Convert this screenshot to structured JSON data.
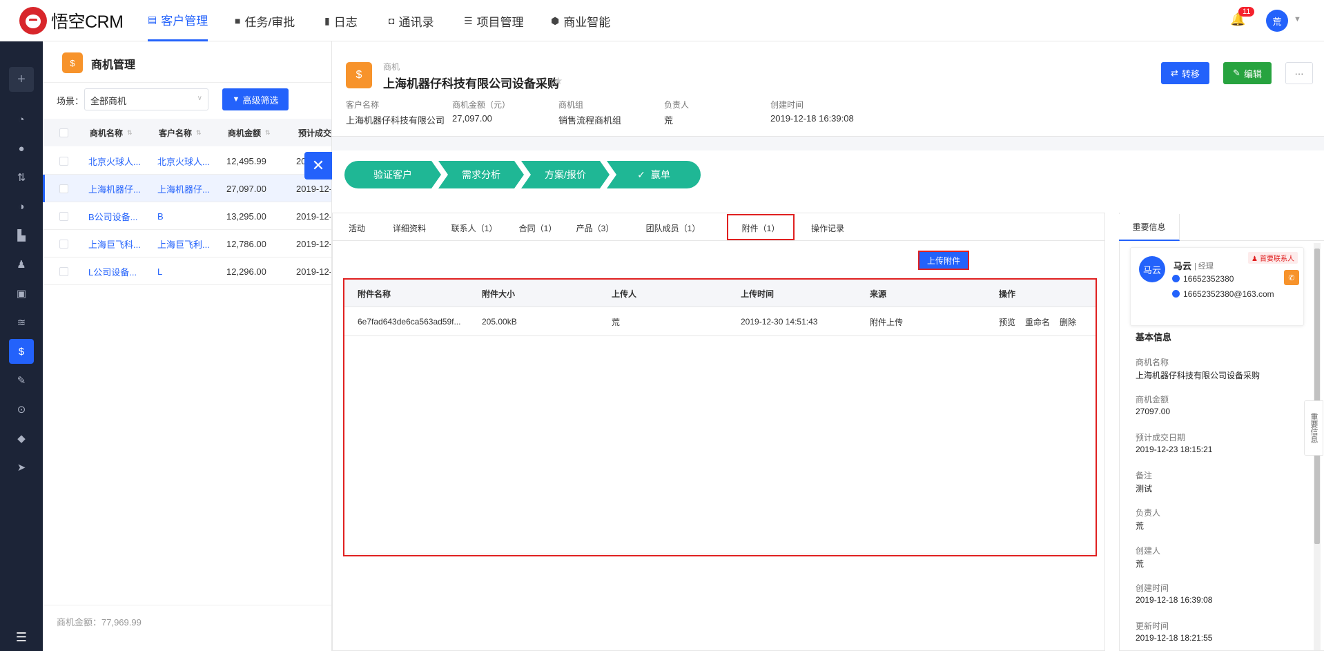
{
  "app": {
    "logo_text": "悟空CRM"
  },
  "nav": [
    {
      "label": "客户管理",
      "icon": "building-icon",
      "active": true
    },
    {
      "label": "任务/审批",
      "icon": "briefcase-icon"
    },
    {
      "label": "日志",
      "icon": "log-icon"
    },
    {
      "label": "通讯录",
      "icon": "contacts-icon"
    },
    {
      "label": "项目管理",
      "icon": "project-icon"
    },
    {
      "label": "商业智能",
      "icon": "bi-icon"
    }
  ],
  "header": {
    "notification_count": "11",
    "user_avatar": "荒"
  },
  "list": {
    "title": "商机管理",
    "scene_label": "场景：",
    "scene_value": "全部商机",
    "filter_button": "高级筛选",
    "columns": [
      "商机名称",
      "客户名称",
      "商机金额",
      "预计成交"
    ],
    "rows": [
      {
        "name": "北京火球人...",
        "customer": "北京火球人...",
        "amount": "12,495.99",
        "date": "20"
      },
      {
        "name": "上海机器仔...",
        "customer": "上海机器仔...",
        "amount": "27,097.00",
        "date": "2019-12-"
      },
      {
        "name": "B公司设备...",
        "customer": "B",
        "amount": "13,295.00",
        "date": "2019-12-"
      },
      {
        "name": "上海巨飞科...",
        "customer": "上海巨飞利...",
        "amount": "12,786.00",
        "date": "2019-12-"
      },
      {
        "name": "L公司设备...",
        "customer": "L",
        "amount": "12,296.00",
        "date": "2019-12-"
      }
    ],
    "summary": "商机金额：77,969.99"
  },
  "detail": {
    "type_label": "商机",
    "name": "上海机器仔科技有限公司设备采购",
    "buttons": {
      "transfer": "转移",
      "edit": "编辑",
      "more": "···"
    },
    "header_fields": [
      {
        "label": "客户名称",
        "value": "上海机器仔科技有限公司"
      },
      {
        "label": "商机金额（元）",
        "value": "27,097.00"
      },
      {
        "label": "商机组",
        "value": "销售流程商机组"
      },
      {
        "label": "负责人",
        "value": "荒"
      },
      {
        "label": "创建时间",
        "value": "2019-12-18 16:39:08"
      }
    ],
    "stages": [
      "验证客户",
      "需求分析",
      "方案/报价",
      "赢单"
    ],
    "tabs": [
      "活动",
      "详细资料",
      "联系人（1）",
      "合同（1）",
      "产品（3）",
      "团队成员（1）",
      "附件（1）",
      "操作记录"
    ],
    "upload_button": "上传附件",
    "attachments": {
      "columns": [
        "附件名称",
        "附件大小",
        "上传人",
        "上传时间",
        "来源",
        "操作"
      ],
      "rows": [
        {
          "name": "6e7fad643de6ca563ad59f...",
          "size": "205.00kB",
          "uploader": "荒",
          "time": "2019-12-30 14:51:43",
          "source": "附件上传",
          "actions": [
            "预览",
            "重命名",
            "删除"
          ]
        }
      ]
    },
    "right_panel": {
      "tab": "重要信息",
      "contact": {
        "avatar": "马云",
        "name": "马云",
        "role": "| 经理",
        "tag": "首要联系人",
        "phone": "16652352380",
        "email": "16652352380@163.com"
      },
      "basic_title": "基本信息",
      "fields": [
        {
          "label": "商机名称",
          "value": "上海机器仔科技有限公司设备采购"
        },
        {
          "label": "商机金额",
          "value": "27097.00"
        },
        {
          "label": "预计成交日期",
          "value": "2019-12-23 18:15:21"
        },
        {
          "label": "备注",
          "value": "测试"
        },
        {
          "label": "负责人",
          "value": "荒"
        },
        {
          "label": "创建人",
          "value": "荒"
        },
        {
          "label": "创建时间",
          "value": "2019-12-18 16:39:08"
        },
        {
          "label": "更新时间",
          "value": "2019-12-18 18:21:55"
        }
      ],
      "side_handle": "重要信息"
    }
  },
  "colors": {
    "primary": "#2362fb",
    "success": "#27a33f",
    "stage": "#1fb795",
    "orange": "#f7932b",
    "highlight": "#e02020",
    "sidebar": "#1c2437"
  }
}
